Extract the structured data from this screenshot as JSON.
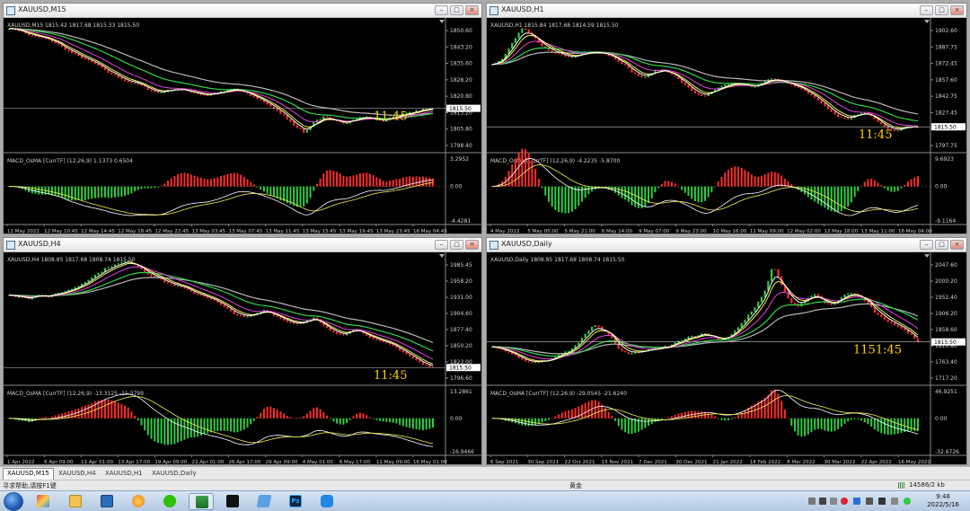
{
  "colors": {
    "bg": "#000000",
    "grid": "#3a3a3a",
    "bull": "#2ecc40",
    "bear": "#ff2a2a",
    "text": "#d0d0d0",
    "ma_gray": "#b8b8b8",
    "ma_green": "#31d34a",
    "ma_magenta": "#e040e0",
    "ma_yellow": "#f4f050",
    "ma_white": "#ffffff",
    "timer": "#ffd400",
    "priceline": "#c8c8c8"
  },
  "windows": [
    {
      "id": "m15",
      "title": "XAUUSD,M15",
      "info": "XAUUSD,M15  1815.42 1817.68 1815.33 1815.50",
      "macd_label": "MACD_OsMA [CurrTF] (12,26,9) 1.1373 0.6504",
      "timer": "11:45",
      "price_tag": "1815.50",
      "price_labels": [
        "1850.60",
        "1843.20",
        "1835.60",
        "1828.20",
        "1820.80",
        "1813.20",
        "1805.80",
        "1798.40"
      ],
      "macd_labels": [
        "3.2952",
        "0.00",
        "-4.4281"
      ],
      "time_labels": [
        "12 May 2022",
        "12 May 10:45",
        "12 May 14:45",
        "12 May 18:45",
        "12 May 22:45",
        "13 May 03:45",
        "13 May 07:45",
        "13 May 11:45",
        "13 May 15:45",
        "13 May 19:45",
        "13 May 23:45",
        "16 May 04:45"
      ],
      "path": [
        1850,
        1849,
        1847,
        1846,
        1845,
        1843,
        1840,
        1838,
        1836,
        1834,
        1831,
        1829,
        1827,
        1826,
        1824,
        1822,
        1823,
        1824,
        1823,
        1822,
        1821,
        1822,
        1823,
        1824,
        1822,
        1820,
        1818,
        1815,
        1812,
        1808,
        1805,
        1810,
        1812,
        1810,
        1809,
        1811,
        1812,
        1811,
        1810,
        1812,
        1813,
        1814,
        1815,
        1815.5
      ],
      "minP": 1798,
      "maxP": 1852,
      "priceNow": 1815.5,
      "macdMin": -4.43,
      "macdMax": 3.3
    },
    {
      "id": "h1",
      "title": "XAUUSD,H1",
      "info": "XAUUSD,H1  1815.84 1817.68 1814.59 1815.50",
      "macd_label": "MACD_OsMA [CurrTF] (12,26,9) -4.2235 -5.8700",
      "timer": "11:45",
      "price_tag": "1815.50",
      "price_labels": [
        "1902.60",
        "1887.75",
        "1872.45",
        "1857.60",
        "1842.75",
        "1827.45",
        "1812.60",
        "1797.75"
      ],
      "macd_labels": [
        "9.6923",
        "0.00",
        "-9.1164"
      ],
      "time_labels": [
        "4 May 2022",
        "5 May 05:00",
        "5 May 21:00",
        "6 May 14:00",
        "9 May 07:00",
        "9 May 23:00",
        "10 May 16:00",
        "11 May 09:00",
        "12 May 02:00",
        "12 May 18:00",
        "13 May 11:00",
        "16 May 04:00"
      ],
      "path": [
        1870,
        1875,
        1890,
        1902,
        1895,
        1885,
        1880,
        1878,
        1876,
        1880,
        1882,
        1880,
        1876,
        1870,
        1862,
        1858,
        1864,
        1866,
        1860,
        1852,
        1845,
        1842,
        1848,
        1852,
        1854,
        1852,
        1850,
        1856,
        1858,
        1854,
        1850,
        1846,
        1840,
        1832,
        1825,
        1822,
        1826,
        1828,
        1820,
        1814,
        1812,
        1816,
        1815.5
      ],
      "minP": 1796,
      "maxP": 1906,
      "priceNow": 1815.5,
      "macdMin": -9.12,
      "macdMax": 9.7
    },
    {
      "id": "h4",
      "title": "XAUUSD,H4",
      "info": "XAUUSD,H4  1808.85 1817.68 1808.74 1815.50",
      "macd_label": "MACD_OsMA [CurrTF] (12,26,9) -13.3125 -11.3799",
      "timer": "11:45",
      "price_tag": "1815.50",
      "price_labels": [
        "1985.45",
        "1958.20",
        "1931.00",
        "1904.60",
        "1877.40",
        "1850.20",
        "1823.00",
        "1796.60"
      ],
      "macd_labels": [
        "13.2861",
        "0.00",
        "-16.9466"
      ],
      "time_labels": [
        "1 Apr 2022",
        "6 Apr 09:00",
        "11 Apr 01:00",
        "13 Apr 17:00",
        "19 Apr 09:00",
        "22 Apr 01:00",
        "26 Apr 17:00",
        "29 Apr 09:00",
        "4 May 01:00",
        "6 May 17:00",
        "11 May 09:00",
        "16 May 01:00"
      ],
      "path": [
        1930,
        1928,
        1925,
        1932,
        1928,
        1934,
        1938,
        1945,
        1955,
        1965,
        1975,
        1980,
        1985,
        1978,
        1965,
        1958,
        1950,
        1945,
        1940,
        1932,
        1928,
        1920,
        1910,
        1900,
        1895,
        1900,
        1908,
        1898,
        1890,
        1885,
        1888,
        1895,
        1880,
        1870,
        1868,
        1878,
        1870,
        1860,
        1855,
        1850,
        1840,
        1830,
        1820,
        1815.5
      ],
      "minP": 1793,
      "maxP": 1990,
      "priceNow": 1815.5,
      "macdMin": -16.95,
      "macdMax": 13.3
    },
    {
      "id": "d1",
      "title": "XAUUSD,Daily",
      "info": "XAUUSD,Daily  1808.85 1817.68 1808.74 1815.50",
      "macd_label": "MACD_OsMA [CurrTF] (12,26,9) -29.0545 -21.6240",
      "timer": "1151:45",
      "price_tag": "1815.50",
      "price_labels": [
        "2047.60",
        "2000.20",
        "1952.40",
        "1906.20",
        "1858.60",
        "1810.80",
        "1763.40",
        "1717.20"
      ],
      "macd_labels": [
        "46.9251",
        "0.00",
        "-32.6726"
      ],
      "time_labels": [
        "6 Sep 2021",
        "30 Sep 2021",
        "22 Oct 2021",
        "15 Nov 2021",
        "7 Dec 2021",
        "30 Dec 2021",
        "21 Jan 2022",
        "14 Feb 2022",
        "8 Mar 2022",
        "30 Mar 2022",
        "22 Apr 2022",
        "16 May 2022"
      ],
      "path": [
        1800,
        1795,
        1785,
        1770,
        1760,
        1755,
        1760,
        1765,
        1780,
        1790,
        1810,
        1840,
        1865,
        1850,
        1830,
        1790,
        1780,
        1785,
        1790,
        1795,
        1800,
        1805,
        1820,
        1830,
        1835,
        1840,
        1830,
        1820,
        1835,
        1860,
        1890,
        1920,
        1960,
        2040,
        1980,
        1930,
        1920,
        1940,
        1955,
        1930,
        1920,
        1945,
        1960,
        1950,
        1930,
        1900,
        1880,
        1870,
        1855,
        1840,
        1815.5
      ],
      "minP": 1700,
      "maxP": 2060,
      "priceNow": 1815.5,
      "macdMin": -32.67,
      "macdMax": 46.93
    }
  ],
  "tabs": [
    "XAUUSD,M15",
    "XAUUSD,H4",
    "XAUUSD,H1",
    "XAUUSD,Daily"
  ],
  "status": {
    "help": "寻求帮助,请按F1键",
    "profile": "黄金",
    "traffic": "14586/2 kb"
  },
  "taskbar": {
    "time": "9:48",
    "date": "2022/5/16"
  }
}
